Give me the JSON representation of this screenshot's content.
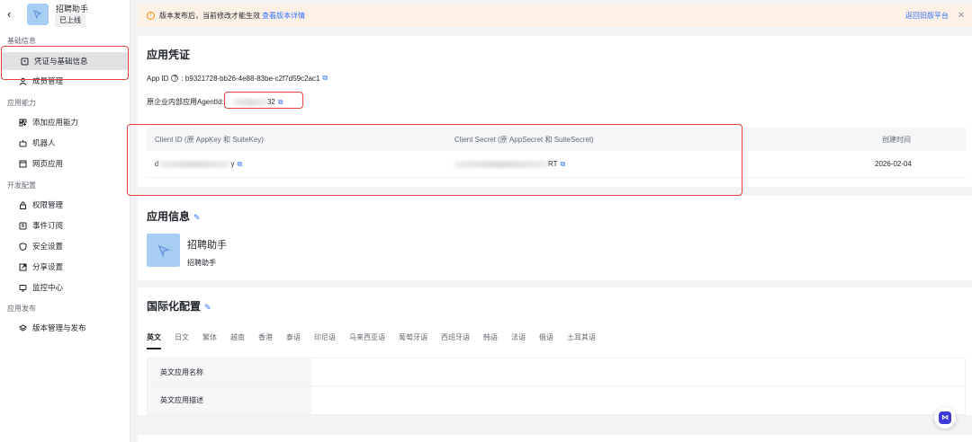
{
  "app": {
    "name": "招聘助手",
    "status": "已上线",
    "back_icon": "chevron-left-icon"
  },
  "sidebar": {
    "sections": [
      {
        "title": "基础信息",
        "items": [
          {
            "label": "凭证与基础信息",
            "icon": "credential-icon",
            "active": true
          },
          {
            "label": "成员管理",
            "icon": "user-icon"
          }
        ]
      },
      {
        "title": "应用能力",
        "items": [
          {
            "label": "添加应用能力",
            "icon": "add-capability-icon"
          },
          {
            "label": "机器人",
            "icon": "robot-icon"
          },
          {
            "label": "网页应用",
            "icon": "webpage-icon"
          }
        ]
      },
      {
        "title": "开发配置",
        "items": [
          {
            "label": "权限管理",
            "icon": "lock-icon"
          },
          {
            "label": "事件订阅",
            "icon": "event-icon"
          },
          {
            "label": "安全设置",
            "icon": "shield-icon"
          },
          {
            "label": "分享设置",
            "icon": "share-icon"
          },
          {
            "label": "监控中心",
            "icon": "monitor-icon"
          }
        ]
      },
      {
        "title": "应用发布",
        "items": [
          {
            "label": "版本管理与发布",
            "icon": "version-icon"
          }
        ]
      }
    ]
  },
  "notice": {
    "text": "版本发布后，当前修改才能生效",
    "link": "查看版本详情",
    "right_link": "返回旧版平台"
  },
  "credentials": {
    "title": "应用凭证",
    "app_id_label": "App ID",
    "app_id": "b9321728-bb26-4e88-83be-c2f7d59c2ac1",
    "agentid_label": "原企业内部应用AgentId:",
    "agentid_visible": "32",
    "table": {
      "headers": [
        "Client ID (原 AppKey 和 SuiteKey)",
        "Client Secret (原 AppSecret 和 SuiteSecret)",
        "创建时间"
      ],
      "row": {
        "client_id_start": "d",
        "client_id_end": "y",
        "client_secret_end": "RT",
        "created": "2026-02-04"
      }
    }
  },
  "app_info": {
    "title": "应用信息",
    "name": "招聘助手",
    "desc": "招聘助手"
  },
  "i18n": {
    "title": "国际化配置",
    "tabs": [
      "英文",
      "日文",
      "繁体",
      "越南",
      "香港",
      "泰语",
      "印尼语",
      "马来西亚语",
      "葡萄牙语",
      "西班牙语",
      "韩语",
      "法语",
      "俄语",
      "土耳其语"
    ],
    "active_tab": 0,
    "rows": [
      {
        "label": "英文应用名称",
        "value": ""
      },
      {
        "label": "英文应用描述",
        "value": ""
      }
    ]
  },
  "colors": {
    "accent": "#3370ff",
    "highlight": "#e64340",
    "notice_bg": "#fdf0e5"
  }
}
